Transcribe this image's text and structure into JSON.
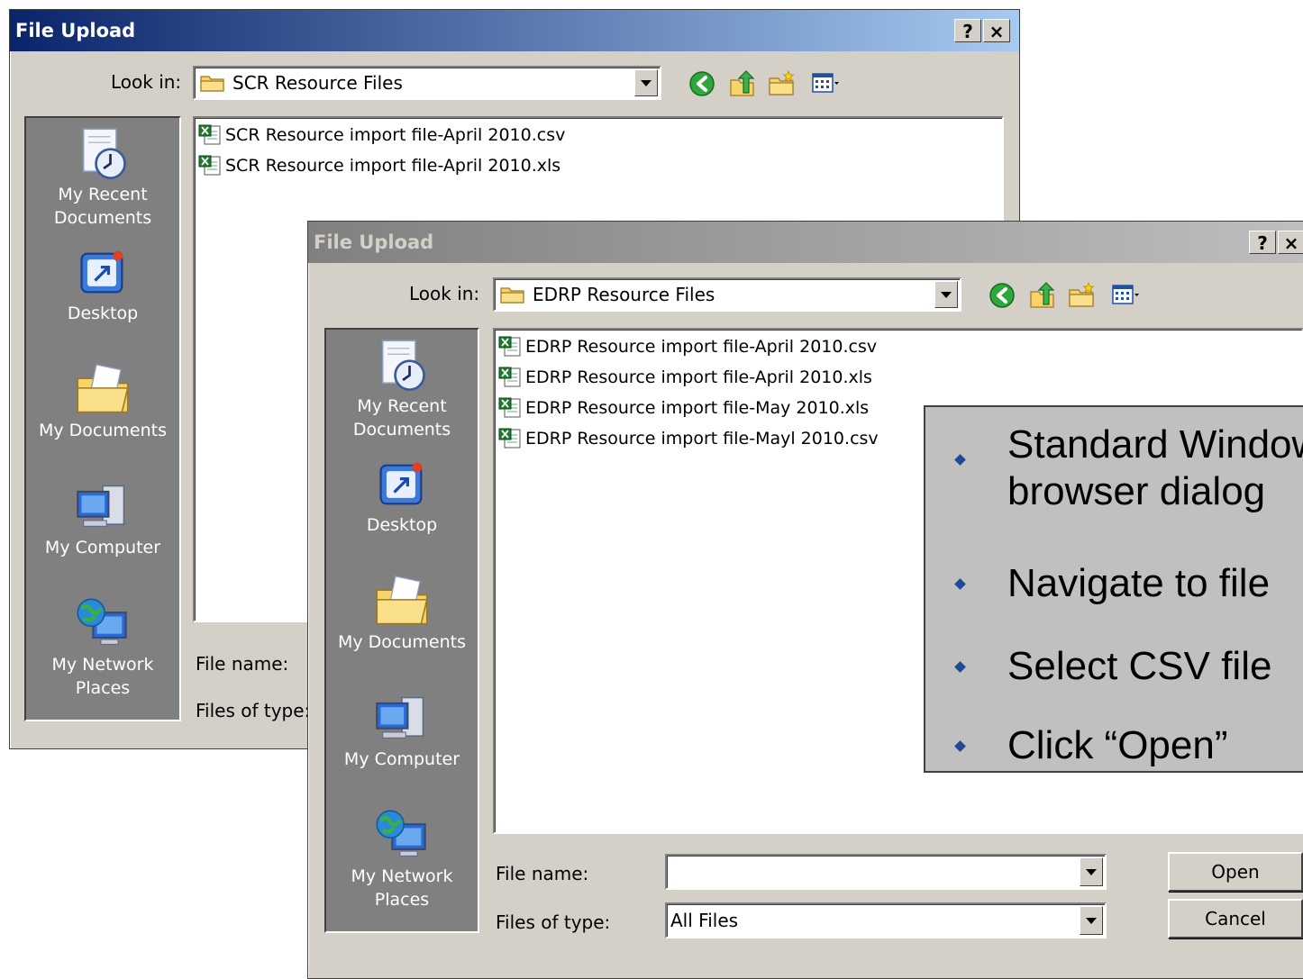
{
  "back_dialog": {
    "title": "File Upload",
    "help_btn": "?",
    "close_btn": "×",
    "look_in_label": "Look in:",
    "look_in_value": "SCR Resource Files",
    "places": [
      {
        "label": "My Recent Documents",
        "icon": "recent-documents-icon"
      },
      {
        "label": "Desktop",
        "icon": "desktop-icon"
      },
      {
        "label": "My Documents",
        "icon": "my-documents-icon"
      },
      {
        "label": "My Computer",
        "icon": "my-computer-icon"
      },
      {
        "label": "My Network Places",
        "icon": "network-places-icon"
      }
    ],
    "files": [
      {
        "name": "SCR Resource import file-April 2010.csv",
        "type": "csv"
      },
      {
        "name": "SCR Resource import file-April 2010.xls",
        "type": "xls"
      }
    ],
    "file_name_label": "File name:",
    "files_of_type_label": "Files of type:"
  },
  "front_dialog": {
    "title": "File Upload",
    "help_btn": "?",
    "close_btn": "×",
    "look_in_label": "Look in:",
    "look_in_value": "EDRP Resource Files",
    "places": [
      {
        "label": "My Recent Documents",
        "icon": "recent-documents-icon"
      },
      {
        "label": "Desktop",
        "icon": "desktop-icon"
      },
      {
        "label": "My Documents",
        "icon": "my-documents-icon"
      },
      {
        "label": "My Computer",
        "icon": "my-computer-icon"
      },
      {
        "label": "My Network Places",
        "icon": "network-places-icon"
      }
    ],
    "files": [
      {
        "name": "EDRP Resource import file-April 2010.csv",
        "type": "csv"
      },
      {
        "name": "EDRP Resource import file-April 2010.xls",
        "type": "xls"
      },
      {
        "name": "EDRP Resource import file-May 2010.xls",
        "type": "xls"
      },
      {
        "name": "EDRP Resource import file-Mayl 2010.csv",
        "type": "csv"
      }
    ],
    "file_name_label": "File name:",
    "file_name_value": "",
    "files_of_type_label": "Files of type:",
    "files_of_type_value": "All Files",
    "open_btn": "Open",
    "cancel_btn": "Cancel"
  },
  "callout": {
    "bullets": [
      "Standard Windows file browser dialog",
      "Navigate to file",
      "Select CSV file",
      "Click “Open”"
    ],
    "bullet_color": "#1f4a9a"
  },
  "colors": {
    "active_title": "#0a246a",
    "inactive_title": "#808080",
    "dialog_face": "#d4d0c8",
    "places_bar": "#808080"
  }
}
